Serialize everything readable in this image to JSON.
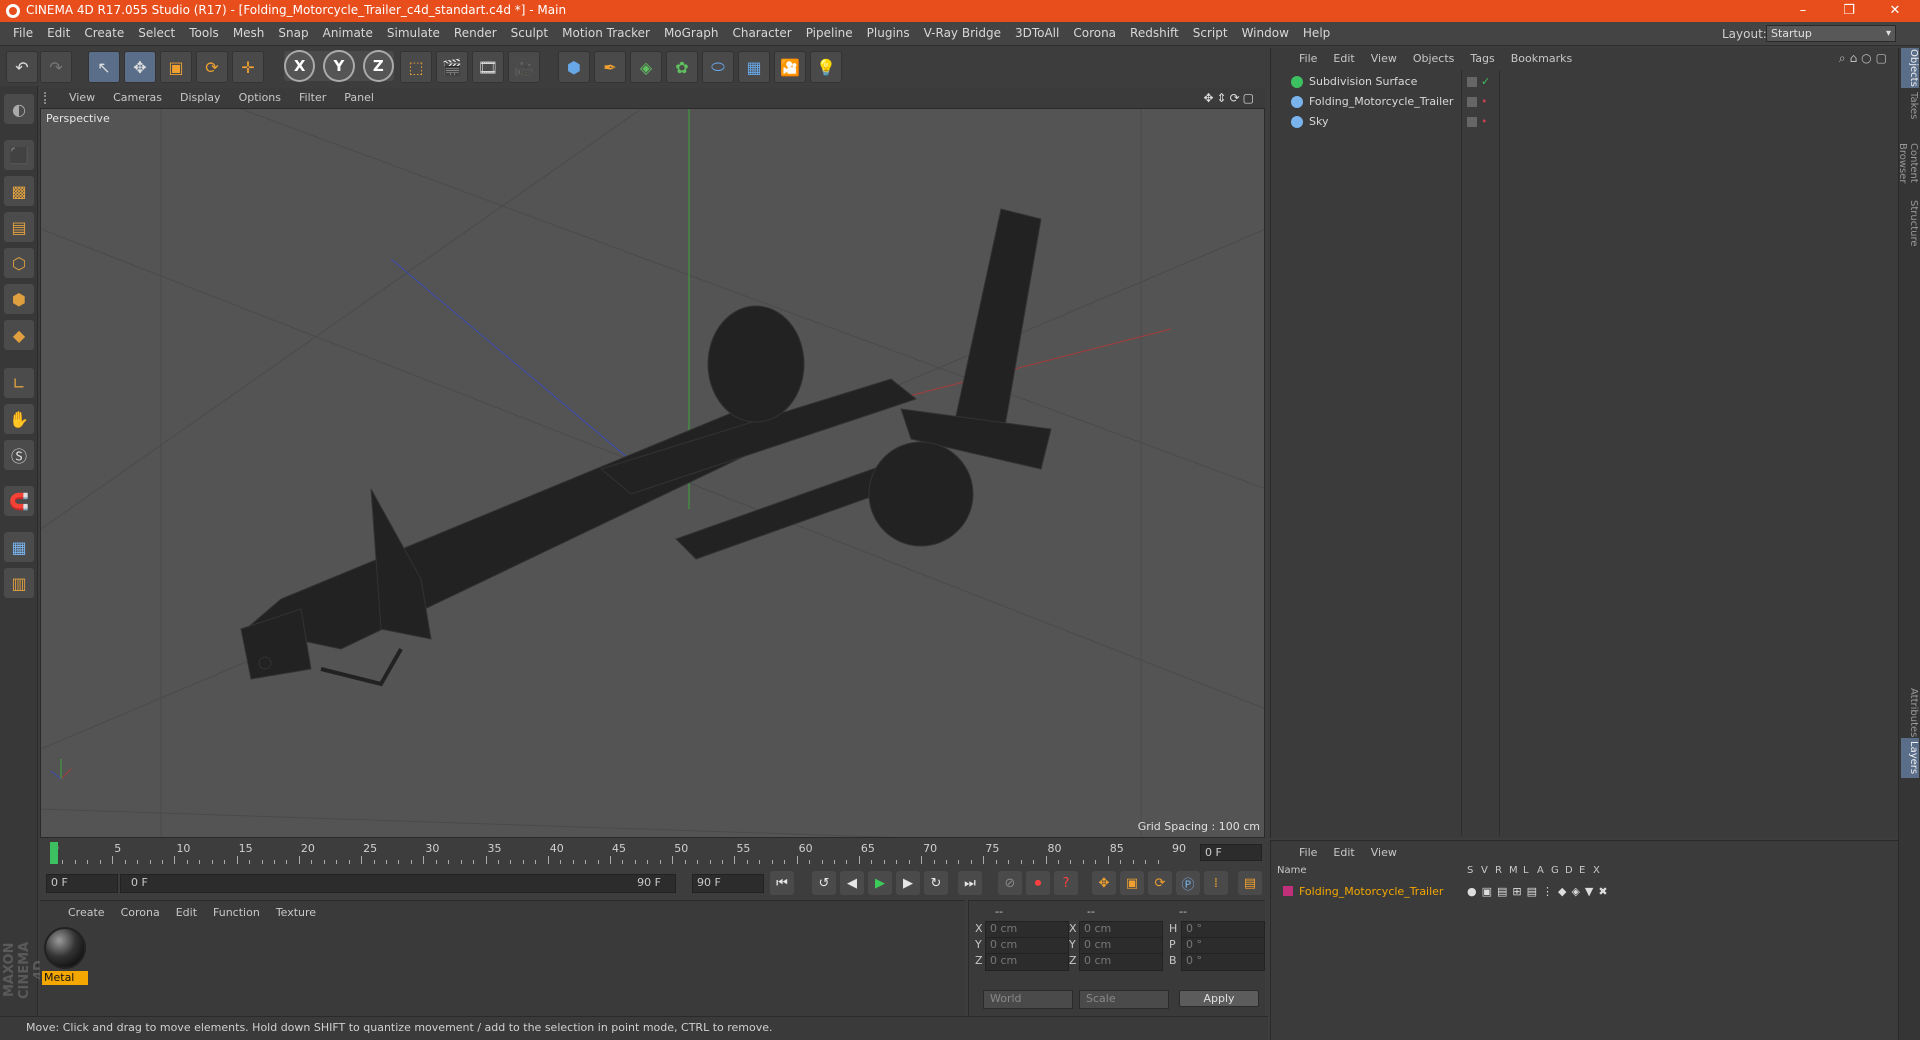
{
  "titlebar": {
    "title": "CINEMA 4D R17.055 Studio (R17) - [Folding_Motorcycle_Trailer_c4d_standart.c4d *] - Main",
    "minimize": "–",
    "restore": "❐",
    "close": "✕"
  },
  "menubar": {
    "items": [
      "File",
      "Edit",
      "Create",
      "Select",
      "Tools",
      "Mesh",
      "Snap",
      "Animate",
      "Simulate",
      "Render",
      "Sculpt",
      "Motion Tracker",
      "MoGraph",
      "Character",
      "Pipeline",
      "Plugins",
      "V-Ray Bridge",
      "3DToAll",
      "Corona",
      "Redshift",
      "Script",
      "Window",
      "Help"
    ],
    "layout_label": "Layout:",
    "layout_value": "Startup"
  },
  "toolbar": {
    "axis_x": "X",
    "axis_y": "Y",
    "axis_z": "Z"
  },
  "viewport": {
    "menu": [
      "View",
      "Cameras",
      "Display",
      "Options",
      "Filter",
      "Panel"
    ],
    "label": "Perspective",
    "grid_spacing": "Grid Spacing : 100 cm"
  },
  "timeline": {
    "ticks": [
      "0",
      "5",
      "10",
      "15",
      "20",
      "25",
      "30",
      "35",
      "40",
      "45",
      "50",
      "55",
      "60",
      "65",
      "70",
      "75",
      "80",
      "85",
      "90"
    ],
    "current_frame": "0 F",
    "start_field": "0 F",
    "range_start": "0 F",
    "range_end": "90 F",
    "end_field": "90 F"
  },
  "material": {
    "menu": [
      "Create",
      "Corona",
      "Edit",
      "Function",
      "Texture"
    ],
    "items": [
      {
        "name": "Metal"
      }
    ]
  },
  "coordinates": {
    "header": [
      "--",
      "--",
      "--"
    ],
    "rows": [
      {
        "axis": "X",
        "pos": "0 cm",
        "size_label": "X",
        "size": "0 cm",
        "rot_label": "H",
        "rot": "0 °"
      },
      {
        "axis": "Y",
        "pos": "0 cm",
        "size_label": "Y",
        "size": "0 cm",
        "rot_label": "P",
        "rot": "0 °"
      },
      {
        "axis": "Z",
        "pos": "0 cm",
        "size_label": "Z",
        "size": "0 cm",
        "rot_label": "B",
        "rot": "0 °"
      }
    ],
    "mode": "World",
    "type": "Scale",
    "apply": "Apply"
  },
  "status": "Move: Click and drag to move elements. Hold down SHIFT to quantize movement / add to the selection in point mode, CTRL to remove.",
  "objects": {
    "menu": [
      "File",
      "Edit",
      "View",
      "Objects",
      "Tags",
      "Bookmarks"
    ],
    "items": [
      {
        "name": "Subdivision Surface",
        "color": "#3cc060"
      },
      {
        "name": "Folding_Motorcycle_Trailer",
        "color": "#79b4ee"
      },
      {
        "name": "Sky",
        "color": "#79b4ee"
      }
    ]
  },
  "layers": {
    "menu": [
      "File",
      "Edit",
      "View"
    ],
    "columns": [
      "Name",
      "S",
      "V",
      "R",
      "M",
      "L",
      "A",
      "G",
      "D",
      "E",
      "X"
    ],
    "row_name": "Folding_Motorcycle_Trailer",
    "row_color": "#c0307a"
  },
  "right_tabs": [
    "Objects",
    "Takes",
    "Content Browser",
    "Structure",
    "Attributes",
    "Layers"
  ],
  "maxon": "MAXON CINEMA 4D"
}
